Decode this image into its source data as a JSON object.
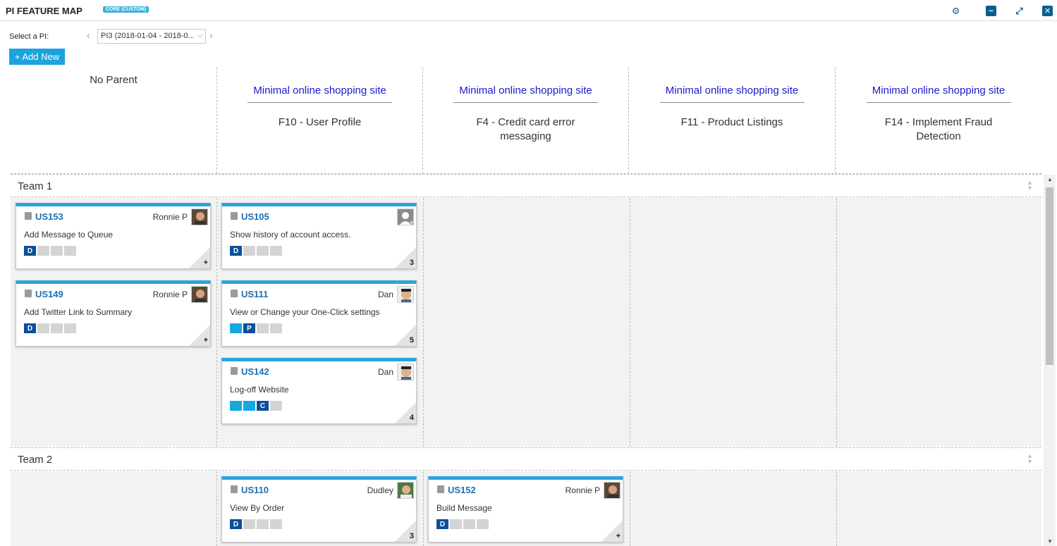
{
  "titlebar": {
    "title": "PI FEATURE MAP",
    "badge": "CORE (CUSTOM)",
    "icons": [
      "gear-icon",
      "minimize-icon",
      "expand-icon",
      "close-icon"
    ]
  },
  "toolbar": {
    "select_label": "Select a PI:",
    "pi_value": "PI3 (2018-01-04 - 2018-0...",
    "add_new_label": "+ Add New"
  },
  "columns": {
    "no_parent": "No Parent",
    "c1": {
      "epic": "Minimal online shopping site",
      "feature": "F10 - User Profile"
    },
    "c2": {
      "epic": "Minimal online shopping site",
      "feature": "F4 - Credit card error messaging"
    },
    "c3": {
      "epic": "Minimal online shopping site",
      "feature": "F11 - Product Listings"
    },
    "c4": {
      "epic": "Minimal online shopping site",
      "feature": "F14 - Implement Fraud Detection"
    }
  },
  "teams": {
    "t1": {
      "name": "Team 1"
    },
    "t2": {
      "name": "Team 2"
    }
  },
  "cards": {
    "us153": {
      "id": "US153",
      "owner": "Ronnie P",
      "title": "Add Message to Queue",
      "state": "D",
      "points": "+"
    },
    "us149": {
      "id": "US149",
      "owner": "Ronnie P",
      "title": "Add Twitter Link to Summary",
      "state": "D",
      "points": "+"
    },
    "us105": {
      "id": "US105",
      "owner": "",
      "title": "Show history of account access.",
      "state": "D",
      "points": "3"
    },
    "us111": {
      "id": "US111",
      "owner": "Dan",
      "title": "View or Change your One-Click settings",
      "state": "P",
      "points": "5"
    },
    "us142": {
      "id": "US142",
      "owner": "Dan",
      "title": "Log-off Website",
      "state": "C",
      "points": "4"
    },
    "us110": {
      "id": "US110",
      "owner": "Dudley",
      "title": "View By Order",
      "state": "D",
      "points": "3"
    },
    "us152": {
      "id": "US152",
      "owner": "Ronnie P",
      "title": "Build Message",
      "state": "D",
      "points": "+"
    }
  },
  "colors": {
    "accent": "#2aa4e0",
    "link": "#1f6fb0",
    "epic": "#1a1acd",
    "state_current": "#0b4f9b",
    "state_done": "#14a8df"
  }
}
